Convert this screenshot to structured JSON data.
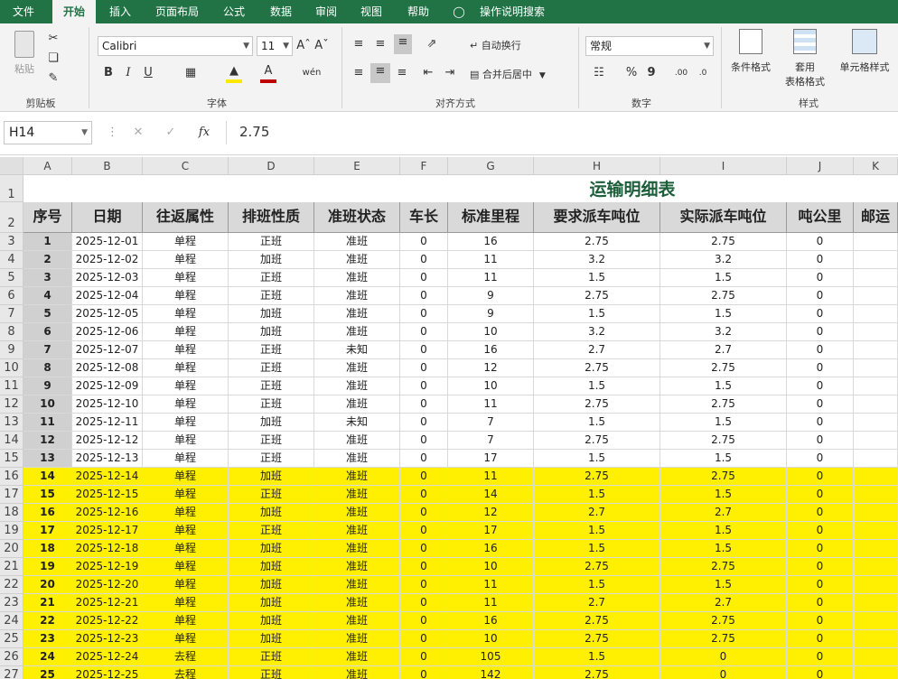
{
  "tabs": [
    "文件",
    "开始",
    "插入",
    "页面布局",
    "公式",
    "数据",
    "审阅",
    "视图",
    "帮助",
    "操作说明搜索"
  ],
  "active_tab": "开始",
  "ribbon": {
    "clipboard": {
      "paste": "粘贴",
      "group": "剪贴板"
    },
    "font": {
      "name": "Calibri",
      "size": "11",
      "bold": "B",
      "italic": "I",
      "underline": "U",
      "group": "字体"
    },
    "alignment": {
      "wrap": "自动换行",
      "merge": "合并后居中",
      "group": "对齐方式"
    },
    "number": {
      "format": "常规",
      "percent": "%",
      "comma": "9",
      "group": "数字"
    },
    "styles": {
      "conditional": "条件格式",
      "table1": "套用",
      "table2": "表格格式",
      "cell": "单元格样式",
      "group": "样式"
    }
  },
  "name_box": "H14",
  "formula": "2.75",
  "columns": [
    "A",
    "B",
    "C",
    "D",
    "E",
    "F",
    "G",
    "H",
    "I",
    "J",
    "K"
  ],
  "sheet_title": "运输明细表",
  "headers": [
    "序号",
    "日期",
    "往返属性",
    "排班性质",
    "准班状态",
    "车长",
    "标准里程",
    "要求派车吨位",
    "实际派车吨位",
    "吨公里",
    "邮运"
  ],
  "rows": [
    [
      "1",
      "2025-12-01",
      "单程",
      "正班",
      "准班",
      "0",
      "16",
      "2.75",
      "2.75",
      "0"
    ],
    [
      "2",
      "2025-12-02",
      "单程",
      "加班",
      "准班",
      "0",
      "11",
      "3.2",
      "3.2",
      "0"
    ],
    [
      "3",
      "2025-12-03",
      "单程",
      "正班",
      "准班",
      "0",
      "11",
      "1.5",
      "1.5",
      "0"
    ],
    [
      "4",
      "2025-12-04",
      "单程",
      "正班",
      "准班",
      "0",
      "9",
      "2.75",
      "2.75",
      "0"
    ],
    [
      "5",
      "2025-12-05",
      "单程",
      "加班",
      "准班",
      "0",
      "9",
      "1.5",
      "1.5",
      "0"
    ],
    [
      "6",
      "2025-12-06",
      "单程",
      "加班",
      "准班",
      "0",
      "10",
      "3.2",
      "3.2",
      "0"
    ],
    [
      "7",
      "2025-12-07",
      "单程",
      "正班",
      "未知",
      "0",
      "16",
      "2.7",
      "2.7",
      "0"
    ],
    [
      "8",
      "2025-12-08",
      "单程",
      "正班",
      "准班",
      "0",
      "12",
      "2.75",
      "2.75",
      "0"
    ],
    [
      "9",
      "2025-12-09",
      "单程",
      "正班",
      "准班",
      "0",
      "10",
      "1.5",
      "1.5",
      "0"
    ],
    [
      "10",
      "2025-12-10",
      "单程",
      "正班",
      "准班",
      "0",
      "11",
      "2.75",
      "2.75",
      "0"
    ],
    [
      "11",
      "2025-12-11",
      "单程",
      "加班",
      "未知",
      "0",
      "7",
      "1.5",
      "1.5",
      "0"
    ],
    [
      "12",
      "2025-12-12",
      "单程",
      "正班",
      "准班",
      "0",
      "7",
      "2.75",
      "2.75",
      "0"
    ],
    [
      "13",
      "2025-12-13",
      "单程",
      "正班",
      "准班",
      "0",
      "17",
      "1.5",
      "1.5",
      "0"
    ],
    [
      "14",
      "2025-12-14",
      "单程",
      "加班",
      "准班",
      "0",
      "11",
      "2.75",
      "2.75",
      "0"
    ],
    [
      "15",
      "2025-12-15",
      "单程",
      "正班",
      "准班",
      "0",
      "14",
      "1.5",
      "1.5",
      "0"
    ],
    [
      "16",
      "2025-12-16",
      "单程",
      "加班",
      "准班",
      "0",
      "12",
      "2.7",
      "2.7",
      "0"
    ],
    [
      "17",
      "2025-12-17",
      "单程",
      "正班",
      "准班",
      "0",
      "17",
      "1.5",
      "1.5",
      "0"
    ],
    [
      "18",
      "2025-12-18",
      "单程",
      "加班",
      "准班",
      "0",
      "16",
      "1.5",
      "1.5",
      "0"
    ],
    [
      "19",
      "2025-12-19",
      "单程",
      "加班",
      "准班",
      "0",
      "10",
      "2.75",
      "2.75",
      "0"
    ],
    [
      "20",
      "2025-12-20",
      "单程",
      "加班",
      "准班",
      "0",
      "11",
      "1.5",
      "1.5",
      "0"
    ],
    [
      "21",
      "2025-12-21",
      "单程",
      "加班",
      "准班",
      "0",
      "11",
      "2.7",
      "2.7",
      "0"
    ],
    [
      "22",
      "2025-12-22",
      "单程",
      "加班",
      "准班",
      "0",
      "16",
      "2.75",
      "2.75",
      "0"
    ],
    [
      "23",
      "2025-12-23",
      "单程",
      "加班",
      "准班",
      "0",
      "10",
      "2.75",
      "2.75",
      "0"
    ],
    [
      "24",
      "2025-12-24",
      "去程",
      "正班",
      "准班",
      "0",
      "105",
      "1.5",
      "0",
      "0"
    ],
    [
      "25",
      "2025-12-25",
      "去程",
      "正班",
      "准班",
      "0",
      "142",
      "2.75",
      "0",
      "0"
    ]
  ],
  "highlight_color": "#ffef00",
  "accent_color": "#217346"
}
